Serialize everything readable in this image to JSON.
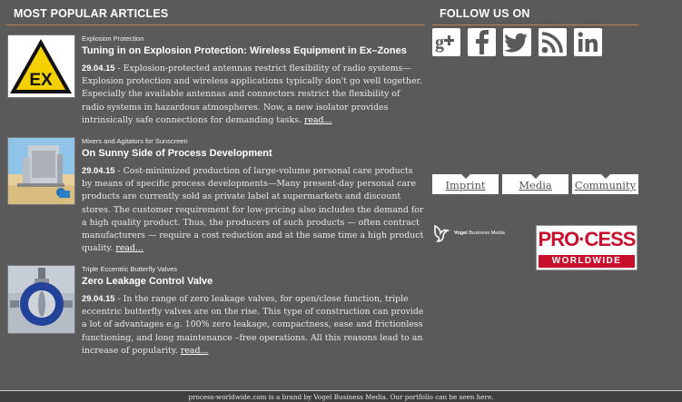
{
  "popular": {
    "heading": "MOST POPULAR ARTICLES",
    "articles": [
      {
        "kicker": "Explosion Protection",
        "title": "Tuning in on Explosion Protection: Wireless Equipment in Ex–Zones",
        "date": "29.04.15",
        "teaser": " - Explosion-protected antennas restrict flexibility of radio systems— Explosion protection and wireless applications typically don't go well together. Especially the available antennas and connectors restrict the flexibility of radio systems in hazardous atmospheres. Now, a new isolator provides intrinsically safe connections for demanding tasks. ",
        "more": "read...",
        "thumb_icon": "ex-warning-sign-icon"
      },
      {
        "kicker": "Mixers and Agitators for Sunscreen",
        "title": "On Sunny Side of Process Development",
        "date": "29.04.15",
        "teaser": " - Cost-minimized production of large-volume personal care products by means of specific process developments—Many present-day personal care products are currently sold as private label at supermarkets and discount stores. The customer requirement for low-pricing also includes the demand for a high quality product. Thus, the producers of such products — often contract manufacturers — require a cost reduction and at the same time a high product quality. ",
        "more": "read...",
        "thumb_icon": "mixer-plant-beach-icon"
      },
      {
        "kicker": "Triple Eccentric Butterfly Valves",
        "title": "Zero Leakage Control Valve",
        "date": "29.04.15",
        "teaser": " - In the range of zero leakage valves, for open/close function, triple eccentric butterfly valves are on the rise. This type of construction can provide a lot of advantages e.g. 100% zero leakage, compactness, ease and frictionless functioning, and long maintenance –free operations. All this reasons lead to an increase of popularity. ",
        "more": "read...",
        "thumb_icon": "butterfly-valve-icon"
      }
    ]
  },
  "follow": {
    "heading": "FOLLOW US ON",
    "icons": [
      "google-plus-icon",
      "facebook-icon",
      "twitter-icon",
      "rss-icon",
      "linkedin-icon"
    ]
  },
  "footer_links": [
    "Imprint",
    "Media",
    "Community"
  ],
  "vogel": {
    "brand_bold": "Vogel",
    "brand_rest": " Business Media"
  },
  "process_logo": {
    "top": "PRO·CESS",
    "bottom": "WORLDWIDE"
  },
  "footer": {
    "text": "process-worldwide.com is a brand by Vogel Business Media. Our portfolio can be seen here."
  },
  "colors": {
    "background": "#5a5a5a",
    "rule": "#c8834a",
    "process_red": "#c8102e"
  }
}
